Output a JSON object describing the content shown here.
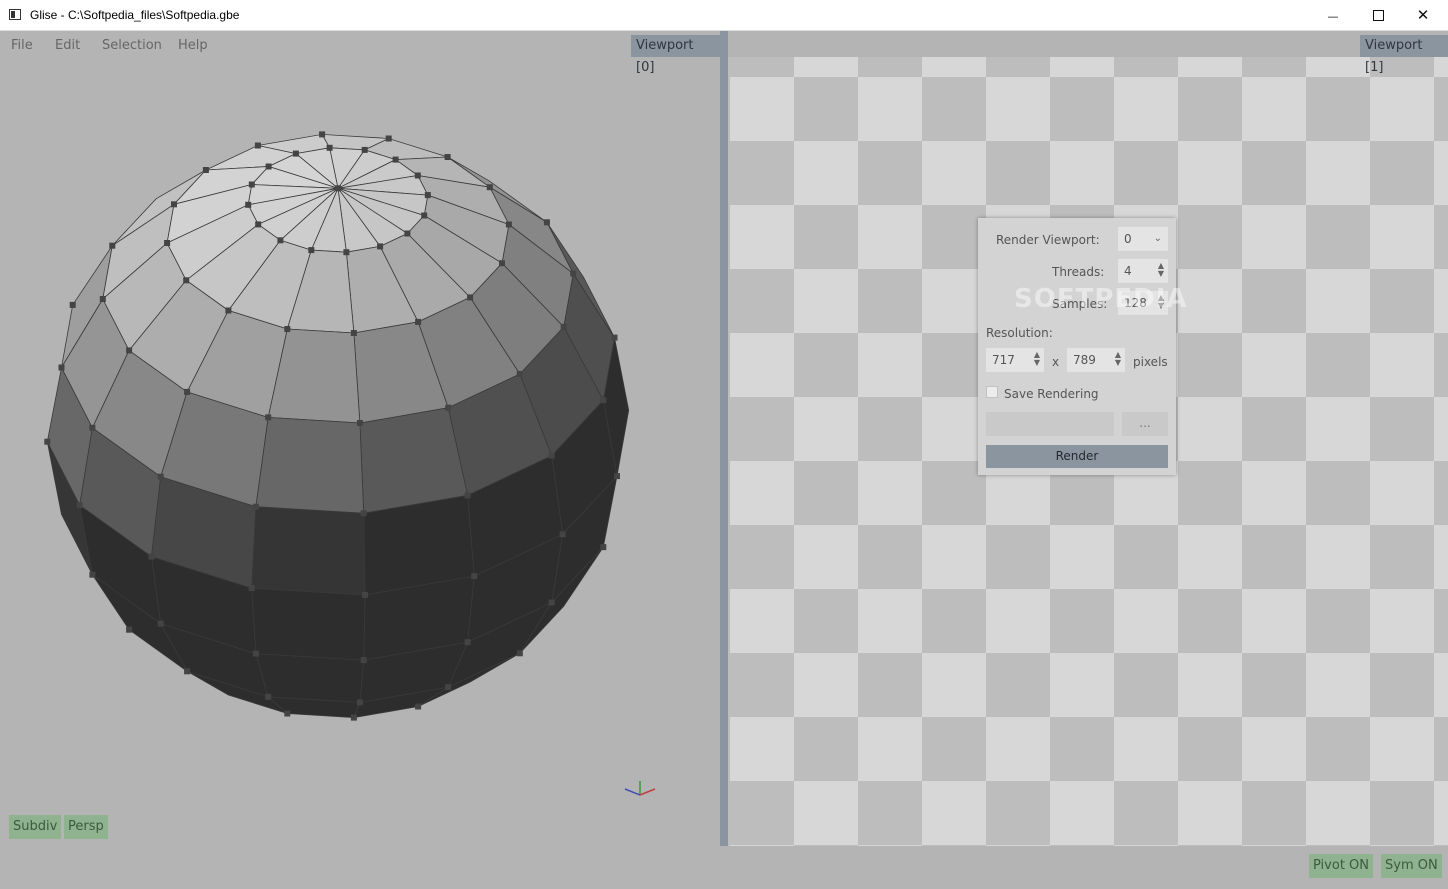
{
  "window": {
    "title": "Glise - C:\\Softpedia_files\\Softpedia.gbe",
    "minimize_glyph": "—",
    "close_glyph": "✕"
  },
  "menu": [
    "File",
    "Edit",
    "Selection",
    "Help"
  ],
  "viewports": {
    "left_label": "Viewport  [0]",
    "right_label": "Viewport  [1]"
  },
  "left_buttons": {
    "subdiv": "Subdiv",
    "persp": "Persp"
  },
  "right_buttons": {
    "pivot": "Pivot  ON",
    "sym": "Sym  ON"
  },
  "render_dialog": {
    "viewport_label": "Render  Viewport:",
    "viewport_value": "0",
    "threads_label": "Threads:",
    "threads_value": "4",
    "samples_label": "Samples:",
    "samples_value": "128",
    "resolution_label": "Resolution:",
    "width_value": "717",
    "x_label": "x",
    "height_value": "789",
    "pixels_label": "pixels",
    "save_label": "Save  Rendering",
    "save_checked": false,
    "browse_label": "...",
    "render_label": "Render"
  },
  "watermark": "SOFTPEDIA",
  "colors": {
    "viewport_bg": "#b4b4b4",
    "label_bg": "#8b95a0",
    "toggle_green": "#8fb28f",
    "checker_light": "#d7d7d7",
    "checker_dark": "#bdbdbd"
  },
  "icons": [
    "app-window-icon",
    "minimize-icon",
    "maximize-icon",
    "close-icon",
    "chevron-down-icon",
    "spin-arrows-icon",
    "axis-gizmo-icon"
  ]
}
